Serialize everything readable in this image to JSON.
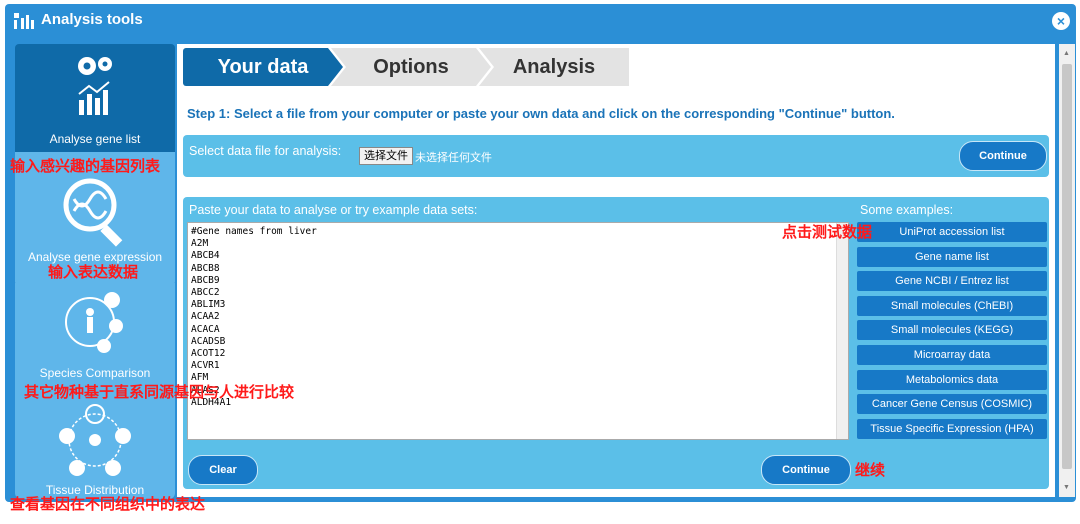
{
  "window": {
    "title": "Analysis tools",
    "close_label": "×"
  },
  "sidebar": {
    "items": [
      {
        "label": "Analyse gene list",
        "icon": "gears-chart-icon"
      },
      {
        "label": "Analyse gene expression",
        "icon": "dna-magnifier-icon"
      },
      {
        "label": "Species Comparison",
        "icon": "species-icon"
      },
      {
        "label": "Tissue Distribution",
        "icon": "organs-icon"
      }
    ]
  },
  "steps": {
    "tabs": [
      "Your data",
      "Options",
      "Analysis"
    ],
    "instruction": "Step 1: Select a file from your computer or paste your own data and click on the corresponding \"Continue\" button."
  },
  "file_panel": {
    "label": "Select data file for analysis:",
    "file_button": "选择文件",
    "file_status": "未选择任何文件",
    "continue": "Continue"
  },
  "paste_panel": {
    "label": "Paste your data to analyse or try example data sets:",
    "examples_label": "Some examples:",
    "lines": [
      "#Gene names from liver",
      "A2M",
      "ABCB4",
      "ABCB8",
      "ABCB9",
      "ABCC2",
      "ABLIM3",
      "ACAA2",
      "ACACA",
      "ACADSB",
      "ACOT12",
      "ACVR1",
      "AFM",
      "ALAS2",
      "ALDH4A1"
    ],
    "examples": [
      "UniProt accession list",
      "Gene name list",
      "Gene NCBI / Entrez list",
      "Small molecules (ChEBI)",
      "Small molecules (KEGG)",
      "Microarray data",
      "Metabolomics data",
      "Cancer Gene Census (COSMIC)",
      "Tissue Specific Expression (HPA)"
    ],
    "clear": "Clear",
    "continue": "Continue"
  },
  "annotations": {
    "gene_list": "输入感兴趣的基因列表",
    "test_data": "点击测试数据",
    "expression": "输入表达数据",
    "species": "其它物种基于直系同源基因与人进行比较",
    "continue_note": "继续",
    "tissue": "查看基因在不同组织中的表达"
  }
}
